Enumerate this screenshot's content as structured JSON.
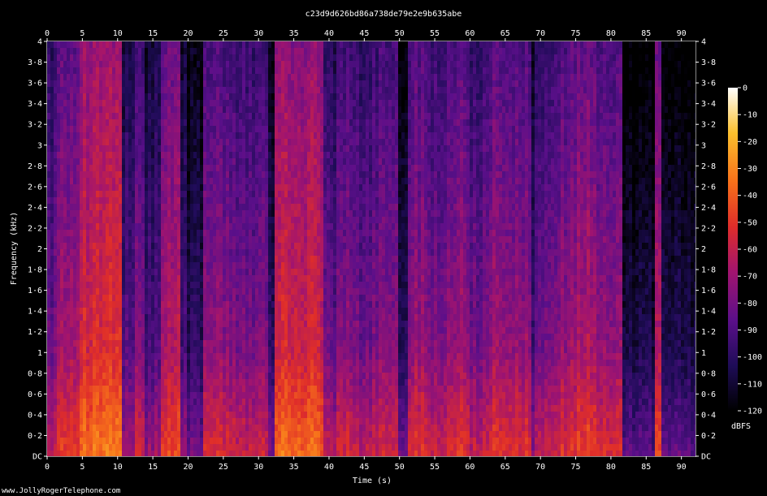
{
  "chart_data": {
    "type": "heatmap",
    "title": "c23d9d626bd86a738de79e2e9b635abe",
    "xlabel": "Time (s)",
    "ylabel": "Frequency (kHz)",
    "xlim": [
      0,
      92
    ],
    "ylim": [
      0,
      4
    ],
    "x_ticks": [
      {
        "v": 0,
        "t": "0"
      },
      {
        "v": 5,
        "t": "5"
      },
      {
        "v": 10,
        "t": "10"
      },
      {
        "v": 15,
        "t": "15"
      },
      {
        "v": 20,
        "t": "20"
      },
      {
        "v": 25,
        "t": "25"
      },
      {
        "v": 30,
        "t": "30"
      },
      {
        "v": 35,
        "t": "35"
      },
      {
        "v": 40,
        "t": "40"
      },
      {
        "v": 45,
        "t": "45"
      },
      {
        "v": 50,
        "t": "50"
      },
      {
        "v": 55,
        "t": "55"
      },
      {
        "v": 60,
        "t": "60"
      },
      {
        "v": 65,
        "t": "65"
      },
      {
        "v": 70,
        "t": "70"
      },
      {
        "v": 75,
        "t": "75"
      },
      {
        "v": 80,
        "t": "80"
      },
      {
        "v": 85,
        "t": "85"
      },
      {
        "v": 90,
        "t": "90"
      }
    ],
    "y_ticks": [
      {
        "v": 0,
        "t": "DC"
      },
      {
        "v": 0.2,
        "t": "0·2"
      },
      {
        "v": 0.4,
        "t": "0·4"
      },
      {
        "v": 0.6,
        "t": "0·6"
      },
      {
        "v": 0.8,
        "t": "0·8"
      },
      {
        "v": 1.0,
        "t": "1"
      },
      {
        "v": 1.2,
        "t": "1·2"
      },
      {
        "v": 1.4,
        "t": "1·4"
      },
      {
        "v": 1.6,
        "t": "1·6"
      },
      {
        "v": 1.8,
        "t": "1·8"
      },
      {
        "v": 2.0,
        "t": "2"
      },
      {
        "v": 2.2,
        "t": "2·2"
      },
      {
        "v": 2.4,
        "t": "2·4"
      },
      {
        "v": 2.6,
        "t": "2·6"
      },
      {
        "v": 2.8,
        "t": "2·8"
      },
      {
        "v": 3.0,
        "t": "3"
      },
      {
        "v": 3.2,
        "t": "3·2"
      },
      {
        "v": 3.4,
        "t": "3·4"
      },
      {
        "v": 3.6,
        "t": "3·6"
      },
      {
        "v": 3.8,
        "t": "3·8"
      },
      {
        "v": 4.0,
        "t": "4"
      }
    ],
    "colorbar": {
      "label": "dBFS",
      "range": [
        -120,
        0
      ],
      "ticks": [
        {
          "v": 0,
          "t": "0"
        },
        {
          "v": -10,
          "t": "-10"
        },
        {
          "v": -20,
          "t": "-20"
        },
        {
          "v": -30,
          "t": "-30"
        },
        {
          "v": -40,
          "t": "-40"
        },
        {
          "v": -50,
          "t": "-50"
        },
        {
          "v": -60,
          "t": "-60"
        },
        {
          "v": -70,
          "t": "-70"
        },
        {
          "v": -80,
          "t": "-80"
        },
        {
          "v": -90,
          "t": "-90"
        },
        {
          "v": -100,
          "t": "-100"
        },
        {
          "v": -110,
          "t": "-110"
        },
        {
          "v": -120,
          "t": "-120"
        }
      ],
      "colors": [
        "#000000",
        "#1e0c57",
        "#5b0f8a",
        "#a1146f",
        "#df2d2a",
        "#f7711a",
        "#fbc02d",
        "#ffffff"
      ]
    },
    "segments": [
      {
        "t0": 0,
        "t1": 1.5,
        "level": -75
      },
      {
        "t0": 1.5,
        "t1": 4.5,
        "level": -62
      },
      {
        "t0": 4.5,
        "t1": 10.5,
        "level": -48
      },
      {
        "t0": 10.5,
        "t1": 12.5,
        "level": -82
      },
      {
        "t0": 12.5,
        "t1": 14,
        "level": -70
      },
      {
        "t0": 14,
        "t1": 16,
        "level": -84
      },
      {
        "t0": 16,
        "t1": 18.7,
        "level": -58
      },
      {
        "t0": 18.7,
        "t1": 20,
        "level": -88
      },
      {
        "t0": 20,
        "t1": 22,
        "level": -95
      },
      {
        "t0": 22,
        "t1": 26,
        "level": -66
      },
      {
        "t0": 26,
        "t1": 29,
        "level": -70
      },
      {
        "t0": 29,
        "t1": 31.5,
        "level": -72
      },
      {
        "t0": 31.5,
        "t1": 32.5,
        "level": -92
      },
      {
        "t0": 32.5,
        "t1": 39,
        "level": -50
      },
      {
        "t0": 39,
        "t1": 41,
        "level": -78
      },
      {
        "t0": 41,
        "t1": 44,
        "level": -68
      },
      {
        "t0": 44,
        "t1": 47,
        "level": -74
      },
      {
        "t0": 47,
        "t1": 50,
        "level": -70
      },
      {
        "t0": 50,
        "t1": 51,
        "level": -95
      },
      {
        "t0": 51,
        "t1": 54,
        "level": -66
      },
      {
        "t0": 54,
        "t1": 57,
        "level": -70
      },
      {
        "t0": 57,
        "t1": 60,
        "level": -64
      },
      {
        "t0": 60,
        "t1": 63,
        "level": -72
      },
      {
        "t0": 63,
        "t1": 66,
        "level": -62
      },
      {
        "t0": 66,
        "t1": 68.5,
        "level": -66
      },
      {
        "t0": 68.5,
        "t1": 69.3,
        "level": -92
      },
      {
        "t0": 69.3,
        "t1": 72,
        "level": -72
      },
      {
        "t0": 72,
        "t1": 75,
        "level": -66
      },
      {
        "t0": 75,
        "t1": 78,
        "level": -60
      },
      {
        "t0": 78,
        "t1": 81.6,
        "level": -64
      },
      {
        "t0": 81.6,
        "t1": 86.3,
        "level": -100
      },
      {
        "t0": 86.3,
        "t1": 87.1,
        "level": -60
      },
      {
        "t0": 87.1,
        "t1": 92,
        "level": -100
      }
    ]
  },
  "footer": {
    "credit": "www.JollyRogerTelephone.com"
  }
}
